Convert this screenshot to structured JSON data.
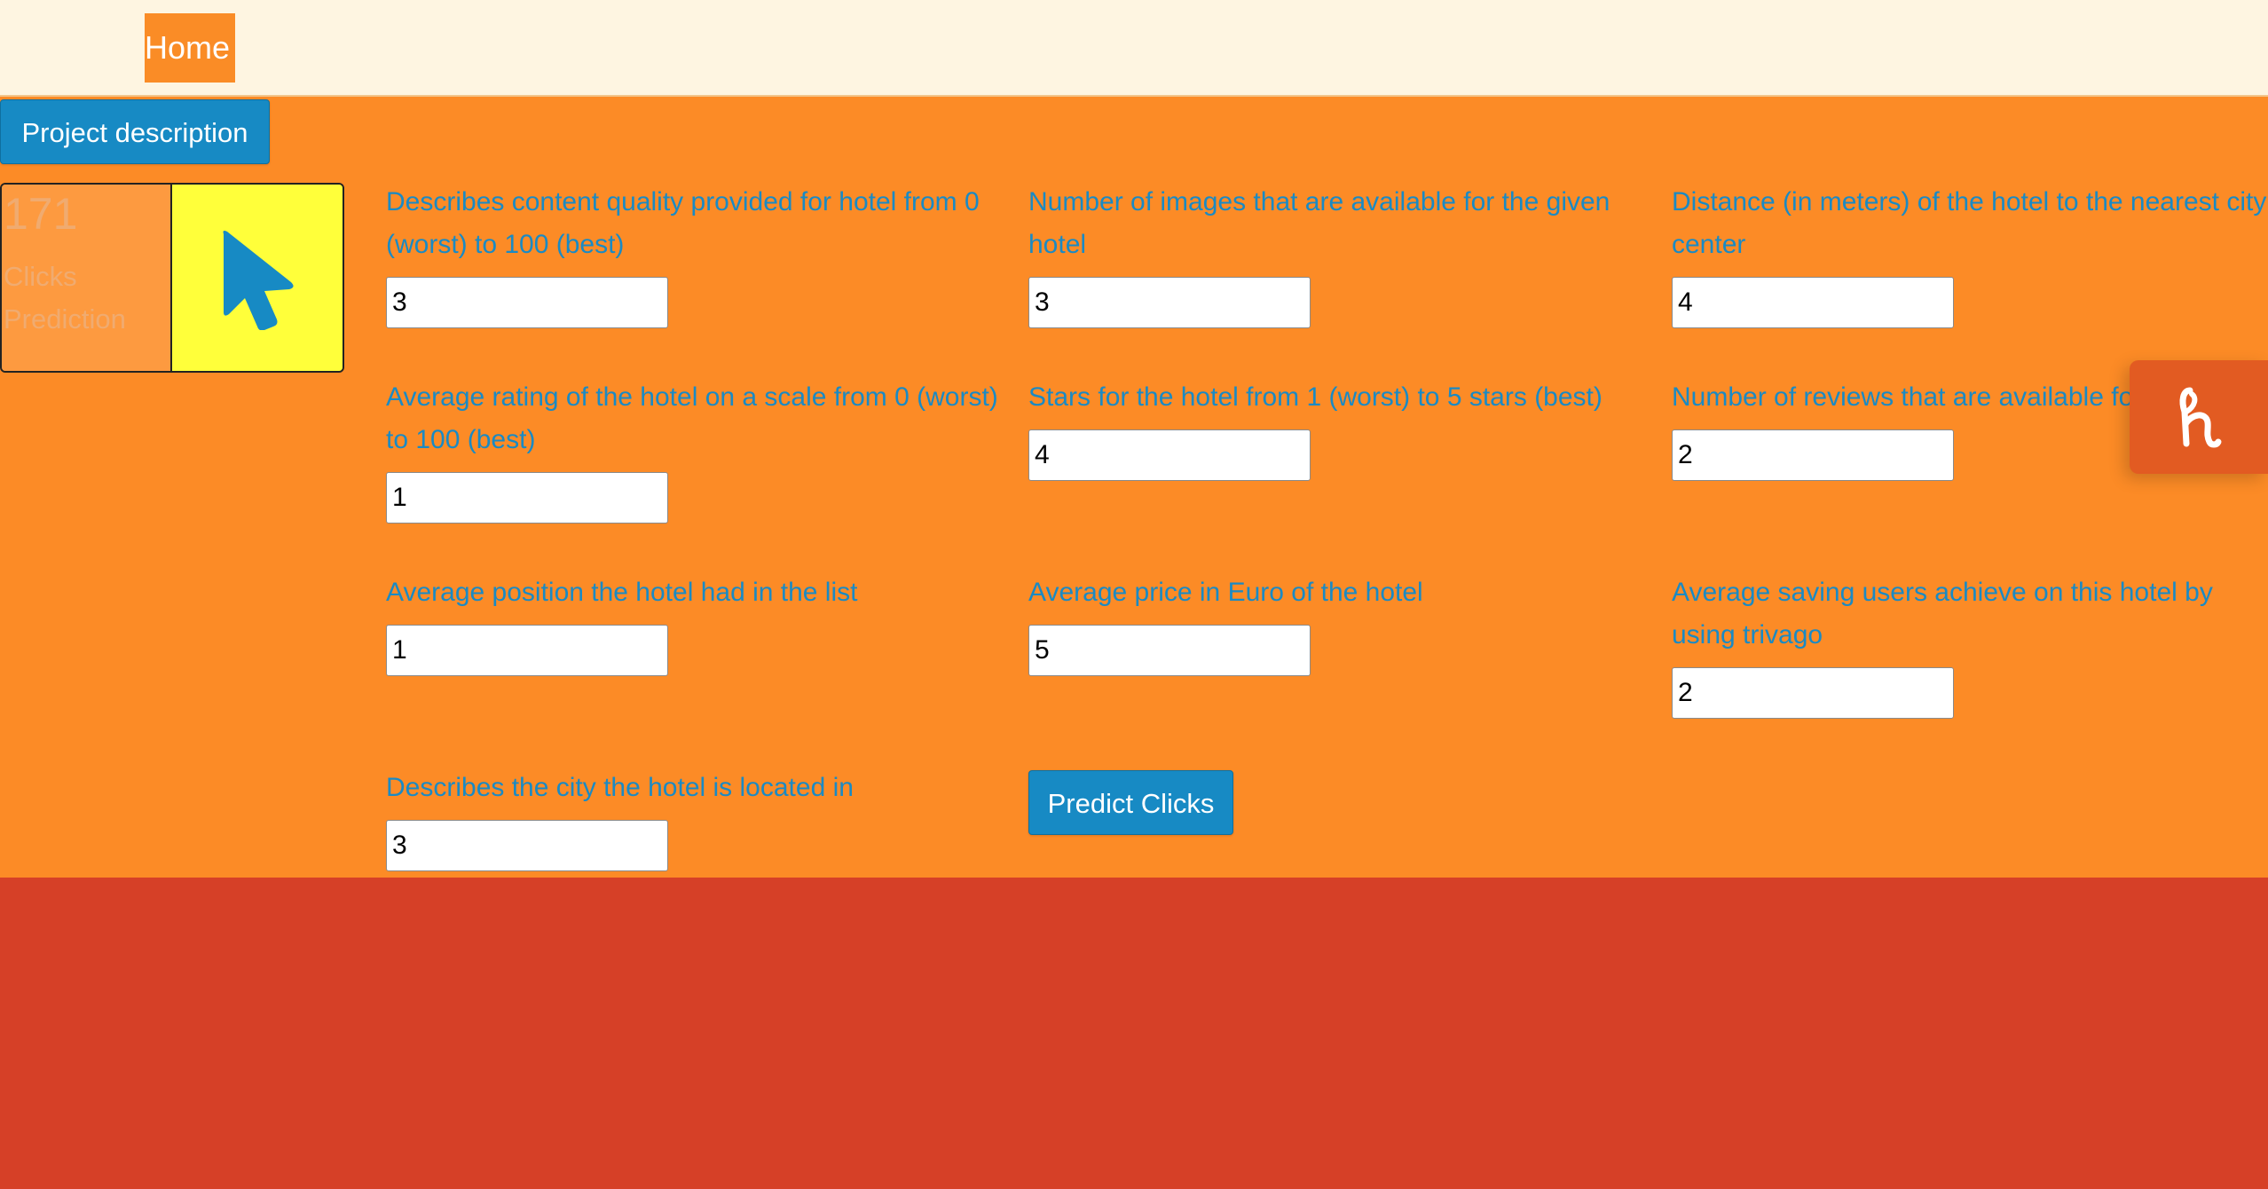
{
  "navbar": {
    "home_label": "Home"
  },
  "actions": {
    "project_description_label": "Project description",
    "predict_label": "Predict Clicks"
  },
  "prediction": {
    "value": "171",
    "label": "Clicks Prediction",
    "icon": "cursor-arrow-icon"
  },
  "fields": {
    "content_score": {
      "label": "Describes content quality provided for hotel from 0 (worst) to 100 (best)",
      "value": "3"
    },
    "n_images": {
      "label": "Number of images that are available for the given hotel",
      "value": "3"
    },
    "distance_to_center": {
      "label": "Distance (in meters) of the hotel to the nearest city center",
      "value": "4"
    },
    "avg_rating": {
      "label": "Average rating of the hotel on a scale from 0 (worst) to 100 (best)",
      "value": "1"
    },
    "stars": {
      "label": "Stars for the hotel from 1 (worst) to 5 stars (best)",
      "value": "4"
    },
    "n_reviews": {
      "label": "Number of reviews that are available for that hotel",
      "value": "2"
    },
    "avg_rank": {
      "label": "Average position the hotel had in the list",
      "value": "1"
    },
    "avg_price": {
      "label": "Average price in Euro of the hotel",
      "value": "5"
    },
    "avg_saving_percent": {
      "label": "Average saving users achieve on this hotel by using trivago",
      "value": "2"
    },
    "city_id": {
      "label": "Describes the city the hotel is located in",
      "value": "3"
    }
  },
  "extension": {
    "icon": "honey-h-icon"
  },
  "colors": {
    "navbar_bg": "#fef5e1",
    "main_bg": "#fc8b26",
    "footer_bg": "#d64027",
    "accent_blue": "#178ac4",
    "highlight_yellow": "#ffff3a"
  }
}
